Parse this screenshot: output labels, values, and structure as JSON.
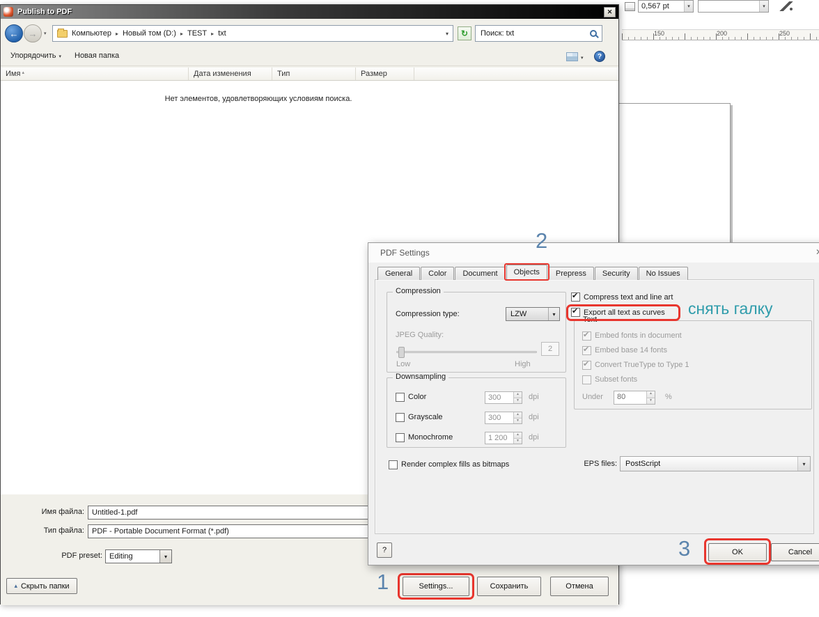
{
  "annotations": {
    "step1": "1",
    "step2": "2",
    "step3": "3",
    "note": "снять галку",
    "accent_red": "#e8362e",
    "number_color": "#5b84ad",
    "note_color": "#2f9cab"
  },
  "corel": {
    "outline_width": "0,567 pt",
    "ruler_marks": [
      "150",
      "200",
      "250"
    ]
  },
  "publish": {
    "title": "Publish to PDF",
    "breadcrumb": {
      "items": [
        "Компьютер",
        "Новый том (D:)",
        "TEST",
        "txt"
      ]
    },
    "search": {
      "text": "Поиск: txt"
    },
    "toolbar": {
      "organize": "Упорядочить",
      "new_folder": "Новая папка"
    },
    "columns": [
      {
        "label": "Имя"
      },
      {
        "label": "Дата изменения"
      },
      {
        "label": "Тип"
      },
      {
        "label": "Размер"
      }
    ],
    "empty_message": "Нет элементов, удовлетворяющих условиям поиска.",
    "fields": {
      "filename_label": "Имя файла:",
      "filename_value": "Untitled-1.pdf",
      "filetype_label": "Тип файла:",
      "filetype_value": "PDF - Portable Document Format (*.pdf)",
      "preset_label": "PDF preset:",
      "preset_value": "Editing"
    },
    "buttons": {
      "hide_folders": "Скрыть папки",
      "settings": "Settings...",
      "save": "Сохранить",
      "cancel": "Отмена"
    }
  },
  "pdf": {
    "title": "PDF Settings",
    "tabs": [
      "General",
      "Color",
      "Document",
      "Objects",
      "Prepress",
      "Security",
      "No Issues"
    ],
    "active_tab": "Objects",
    "compression": {
      "group": "Compression",
      "type_label": "Compression type:",
      "type_value": "LZW",
      "quality_label": "JPEG Quality:",
      "quality_value": "2",
      "low": "Low",
      "high": "High"
    },
    "downsampling": {
      "group": "Downsampling",
      "rows": [
        {
          "label": "Color",
          "value": "300",
          "unit": "dpi",
          "checked": false
        },
        {
          "label": "Grayscale",
          "value": "300",
          "unit": "dpi",
          "checked": false
        },
        {
          "label": "Monochrome",
          "value": "1 200",
          "unit": "dpi",
          "checked": false
        }
      ]
    },
    "render_bitmaps": "Render complex fills as bitmaps",
    "options": [
      {
        "label": "Compress text and line art",
        "checked": true
      },
      {
        "label": "Export all text as curves",
        "checked": true
      }
    ],
    "text_group": {
      "group": "Text",
      "items": [
        {
          "label": "Embed fonts in document",
          "checked": true
        },
        {
          "label": "Embed base 14 fonts",
          "checked": true
        },
        {
          "label": "Convert TrueType to Type 1",
          "checked": true
        },
        {
          "label": "Subset fonts",
          "checked": false
        }
      ],
      "under_label": "Under",
      "under_value": "80",
      "percent": "%"
    },
    "eps_label": "EPS files:",
    "eps_value": "PostScript",
    "help": "?",
    "ok": "OK",
    "cancel": "Cancel"
  }
}
